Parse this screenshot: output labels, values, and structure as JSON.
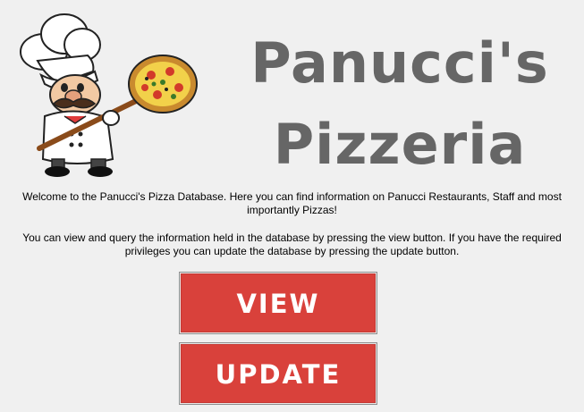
{
  "brand": {
    "line1": "Panucci's",
    "line2": "Pizzeria",
    "logo_icon": "chef-with-pizza-icon"
  },
  "intro": {
    "paragraph1": "Welcome to the Panucci's Pizza Database. Here you can find information on Panucci Restaurants, Staff and most importantly Pizzas!",
    "paragraph2": "You can view and query the information held in the database by pressing the view button.  If you have the required privileges you can update the database by pressing the update button."
  },
  "buttons": {
    "view_label": "VIEW",
    "update_label": "UPDATE",
    "color": "#d9413b"
  }
}
